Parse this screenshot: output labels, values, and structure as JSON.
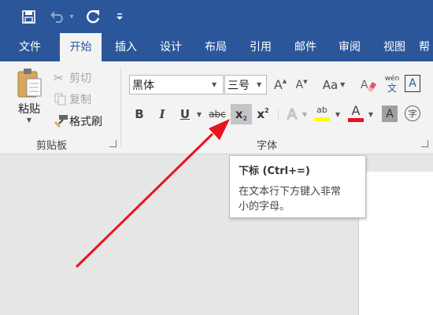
{
  "qat": {
    "icons": [
      "save-icon",
      "undo-icon",
      "redo-icon",
      "customize-qat-icon"
    ],
    "undo_arrow": "▾"
  },
  "tabs": [
    "文件",
    "开始",
    "插入",
    "设计",
    "布局",
    "引用",
    "邮件",
    "审阅",
    "视图",
    "帮"
  ],
  "active_tab": "开始",
  "clipboard": {
    "paste": "粘贴",
    "cut": "剪切",
    "copy": "复制",
    "format_painter": "格式刷",
    "group_label": "剪贴板"
  },
  "font": {
    "font_name": "黑体",
    "font_size": "三号",
    "grow_glyph": "A",
    "shrink_glyph": "A",
    "case_glyph": "Aa",
    "phonetic_top": "wén",
    "phonetic_bottom": "文",
    "border_char": "A",
    "bold": "B",
    "italic": "I",
    "underline": "U",
    "strikethrough": "abc",
    "subscript_base": "x",
    "subscript_mark": "2",
    "superscript_base": "x",
    "superscript_mark": "2",
    "effects": "A",
    "highlight_text": "ab",
    "font_color": "A",
    "shading": "A",
    "encircle": "字",
    "group_label": "字体"
  },
  "tooltip": {
    "title": "下标 (Ctrl+=)",
    "description_line1": "在文本行下方键入非常",
    "description_line2": "小的字母。"
  },
  "colors": {
    "brand": "#2b579a",
    "highlight": "#ffff00",
    "font_color": "#e81123",
    "arrow": "#e8141b"
  }
}
